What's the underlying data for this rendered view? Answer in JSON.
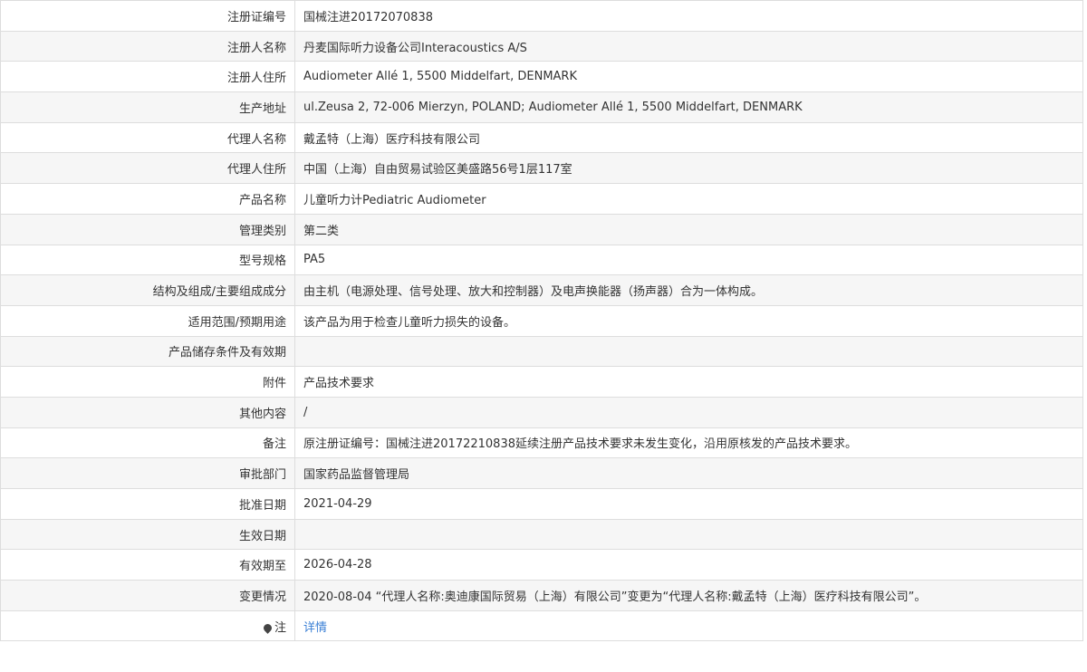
{
  "rows": [
    {
      "label": "注册证编号",
      "value": "国械注进20172070838"
    },
    {
      "label": "注册人名称",
      "value": "丹麦国际听力设备公司Interacoustics A/S"
    },
    {
      "label": "注册人住所",
      "value": "Audiometer Allé 1, 5500 Middelfart, DENMARK"
    },
    {
      "label": "生产地址",
      "value": "ul.Zeusa 2, 72-006 Mierzyn, POLAND; Audiometer Allé 1, 5500 Middelfart, DENMARK"
    },
    {
      "label": "代理人名称",
      "value": "戴孟特（上海）医疗科技有限公司"
    },
    {
      "label": "代理人住所",
      "value": "中国（上海）自由贸易试验区美盛路56号1层117室"
    },
    {
      "label": "产品名称",
      "value": "儿童听力计Pediatric Audiometer"
    },
    {
      "label": "管理类别",
      "value": "第二类"
    },
    {
      "label": "型号规格",
      "value": "PA5"
    },
    {
      "label": "结构及组成/主要组成成分",
      "value": "由主机（电源处理、信号处理、放大和控制器）及电声换能器（扬声器）合为一体构成。"
    },
    {
      "label": "适用范围/预期用途",
      "value": "该产品为用于检查儿童听力损失的设备。"
    },
    {
      "label": "产品储存条件及有效期",
      "value": ""
    },
    {
      "label": "附件",
      "value": "产品技术要求"
    },
    {
      "label": "其他内容",
      "value": "/"
    },
    {
      "label": "备注",
      "value": "原注册证编号：国械注进20172210838延续注册产品技术要求未发生变化，沿用原核发的产品技术要求。"
    },
    {
      "label": "审批部门",
      "value": "国家药品监督管理局"
    },
    {
      "label": "批准日期",
      "value": "2021-04-29"
    },
    {
      "label": "生效日期",
      "value": ""
    },
    {
      "label": "有效期至",
      "value": "2026-04-28"
    },
    {
      "label": "变更情况",
      "value": "2020-08-04 “代理人名称:奥迪康国际贸易（上海）有限公司”变更为“代理人名称:戴孟特（上海）医疗科技有限公司”。"
    }
  ],
  "note_row": {
    "icon": "pin-icon",
    "label": "注",
    "link_text": "详情"
  }
}
